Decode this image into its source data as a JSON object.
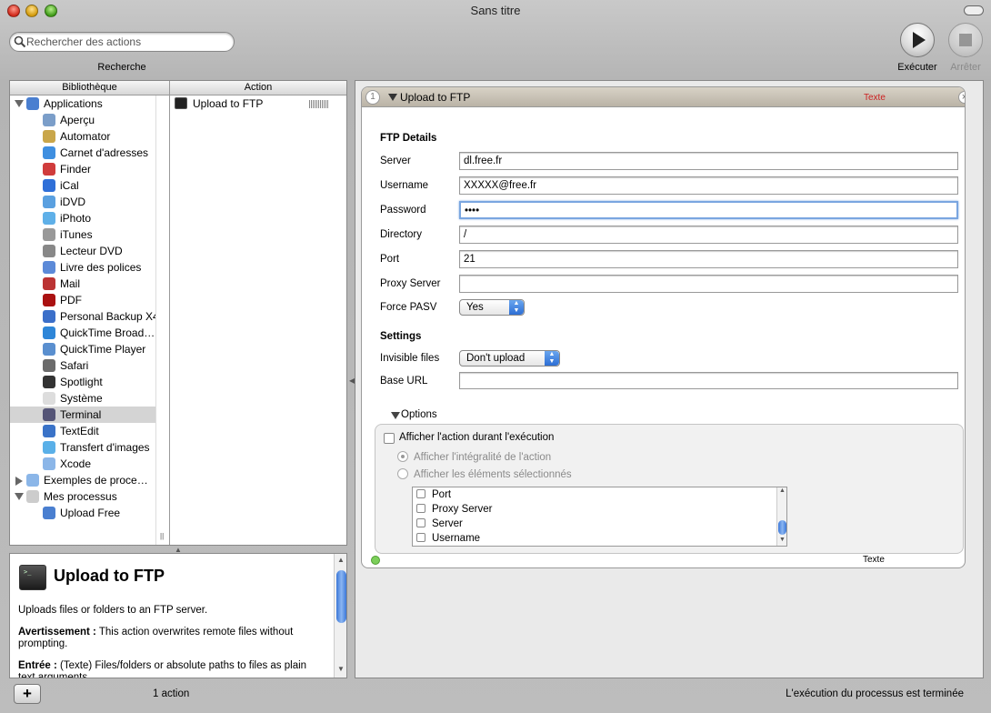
{
  "window": {
    "title": "Sans titre"
  },
  "search": {
    "placeholder": "Rechercher des actions",
    "label": "Recherche"
  },
  "toolbar": {
    "run_label": "Exécuter",
    "stop_label": "Arrêter"
  },
  "library": {
    "col1_header": "Bibliothèque",
    "col2_header": "Action",
    "tree": [
      {
        "label": "Applications",
        "icon": "apps-folder-icon",
        "expanded": true,
        "level": 0
      },
      {
        "label": "Aperçu",
        "icon": "preview-icon",
        "level": 1
      },
      {
        "label": "Automator",
        "icon": "automator-icon",
        "level": 1
      },
      {
        "label": "Carnet d'adresses",
        "icon": "address-book-icon",
        "level": 1
      },
      {
        "label": "Finder",
        "icon": "finder-icon",
        "level": 1
      },
      {
        "label": "iCal",
        "icon": "ical-icon",
        "level": 1
      },
      {
        "label": "iDVD",
        "icon": "idvd-icon",
        "level": 1
      },
      {
        "label": "iPhoto",
        "icon": "iphoto-icon",
        "level": 1
      },
      {
        "label": "iTunes",
        "icon": "itunes-icon",
        "level": 1
      },
      {
        "label": "Lecteur DVD",
        "icon": "dvd-player-icon",
        "level": 1
      },
      {
        "label": "Livre des polices",
        "icon": "font-book-icon",
        "level": 1
      },
      {
        "label": "Mail",
        "icon": "mail-icon",
        "level": 1
      },
      {
        "label": "PDF",
        "icon": "pdf-icon",
        "level": 1
      },
      {
        "label": "Personal Backup X4",
        "icon": "backup-icon",
        "level": 1
      },
      {
        "label": "QuickTime Broad…",
        "icon": "quicktime-broadcaster-icon",
        "level": 1
      },
      {
        "label": "QuickTime Player",
        "icon": "quicktime-icon",
        "level": 1
      },
      {
        "label": "Safari",
        "icon": "safari-icon",
        "level": 1
      },
      {
        "label": "Spotlight",
        "icon": "spotlight-icon",
        "level": 1
      },
      {
        "label": "Système",
        "icon": "system-icon",
        "level": 1
      },
      {
        "label": "Terminal",
        "icon": "terminal-icon",
        "level": 1,
        "selected": true
      },
      {
        "label": "TextEdit",
        "icon": "textedit-icon",
        "level": 1
      },
      {
        "label": "Transfert d'images",
        "icon": "image-capture-icon",
        "level": 1
      },
      {
        "label": "Xcode",
        "icon": "xcode-icon",
        "level": 1
      },
      {
        "label": "Exemples de proce…",
        "icon": "folder-icon",
        "expanded": false,
        "level": 0
      },
      {
        "label": "Mes processus",
        "icon": "folder-icon",
        "expanded": true,
        "level": 0
      },
      {
        "label": "Upload Free",
        "icon": "workflow-file-icon",
        "level": 1
      }
    ],
    "actions": [
      {
        "label": "Upload to FTP",
        "icon": "terminal-icon"
      }
    ]
  },
  "description": {
    "title": "Upload to FTP",
    "summary": "Uploads files or folders to an FTP server.",
    "warning_label": "Avertissement :",
    "warning_text": " This action overwrites remote files without prompting.",
    "input_label": "Entrée :",
    "input_text": " (Texte) Files/folders or absolute paths to files as plain text arguments."
  },
  "action_card": {
    "number": "1",
    "title": "Upload to FTP",
    "input_type": "Texte",
    "output_type": "Texte",
    "close_glyph": "×",
    "ftp_section": "FTP Details",
    "fields": {
      "server": {
        "label": "Server",
        "value": "dl.free.fr"
      },
      "username": {
        "label": "Username",
        "value": "XXXXX@free.fr"
      },
      "password": {
        "label": "Password",
        "value": "••••"
      },
      "directory": {
        "label": "Directory",
        "value": "/"
      },
      "port": {
        "label": "Port",
        "value": "21"
      },
      "proxy": {
        "label": "Proxy Server",
        "value": ""
      },
      "force_pasv": {
        "label": "Force PASV",
        "value": "Yes"
      }
    },
    "settings_section": "Settings",
    "settings": {
      "invisible_files": {
        "label": "Invisible files",
        "value": "Don't upload"
      },
      "base_url": {
        "label": "Base URL",
        "value": ""
      }
    },
    "options": {
      "label": "Options",
      "show_action": "Afficher l'action durant l'exécution",
      "radio_all": "Afficher l'intégralité de l'action",
      "radio_selected": "Afficher les éléments sélectionnés",
      "list_items": [
        "Port",
        "Proxy Server",
        "Server",
        "Username"
      ]
    }
  },
  "statusbar": {
    "add_glyph": "+",
    "count": "1 action",
    "message": "L'exécution du processus est terminée"
  }
}
